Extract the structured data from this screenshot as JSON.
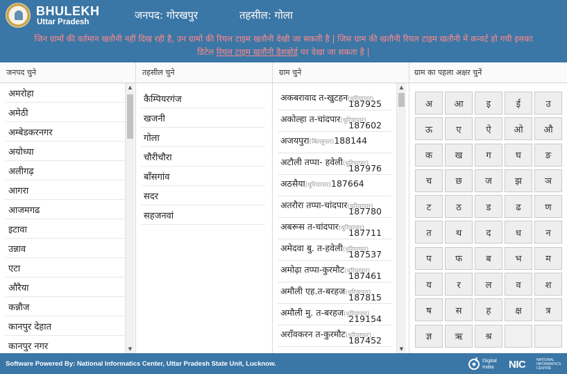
{
  "header": {
    "brand_title": "BHULEKH",
    "brand_subtitle": "Uttar Pradesh",
    "janpad_label": "जनपद: गोरखपुर",
    "tehsil_label": "तहसील: गोला"
  },
  "notice": {
    "line1": "जिन ग्रामों की वर्तमान खतौनी नहीं दिख रही है, उन ग्रामों की रियल टाइम खतौनी देखी जा सकती है | जिस ग्राम की खतौनी रियल टाइम खतौनी में कन्वर्ट हो गयी इसका",
    "line2_prefix": "डिटेल ",
    "line2_link": "रियल टाइम खतौनी डैशबोर्ड",
    "line2_suffix": " पर देखा जा सकता है |"
  },
  "columns": {
    "janpad_header": "जनपद चुने",
    "tehsil_header": "तहसील चुने",
    "gram_header": "ग्राम चुने",
    "letters_header": "ग्राम का पहला अक्षर चुनें"
  },
  "janpad_list": [
    "अमरोहा",
    "अमेठी",
    "अम्बेडकरनगर",
    "अयोध्या",
    "अलीगढ़",
    "आगरा",
    "आजमगढ",
    "इटावा",
    "उन्नाव",
    "एटा",
    "औरैया",
    "कन्नौज",
    "कानपुर देहात",
    "कानपुर नगर"
  ],
  "tehsil_list": [
    "कैम्पियरगंज",
    "खजनी",
    "गोला",
    "चौरीचौरा",
    "बाँसगांव",
    "सदर",
    "सहजनवां"
  ],
  "gram_list": [
    {
      "name": "अकबरावाद त-खुटहन",
      "tag": "(धुरियापार)",
      "code": "187925",
      "two": true
    },
    {
      "name": "अकोल्हा त-चांदपार",
      "tag": "(धुरियापार)",
      "code": "187602",
      "two": true
    },
    {
      "name": "अजयपुरा",
      "tag": "(बिल्लूपार)",
      "code": "188144",
      "two": false
    },
    {
      "name": "अटौली तप्पा- हवेली",
      "tag": "(धुरियापार)",
      "code": "187976",
      "two": true
    },
    {
      "name": "अठसैया",
      "tag": "(धुरियापार)",
      "code": "187664",
      "two": false
    },
    {
      "name": "अतरौरा तप्पा-चांदपार",
      "tag": "(धुरियापार)",
      "code": "187780",
      "two": true
    },
    {
      "name": "अबरूस त-चांदपार",
      "tag": "(धुरियापार)",
      "code": "187711",
      "two": true
    },
    {
      "name": "अमेदवा बु. त-हवेली",
      "tag": "(धुरियापार)",
      "code": "187537",
      "two": true
    },
    {
      "name": "अमोढ़ा तप्पा-कुरमौट",
      "tag": "(धुरियापार)",
      "code": "187461",
      "two": true
    },
    {
      "name": "अमौली एह.त-बरहज",
      "tag": "(धुरियापार)",
      "code": "187815",
      "two": true
    },
    {
      "name": "अमौली मु. त-बरहज",
      "tag": "(धुरियापार)",
      "code": "219154",
      "two": true
    },
    {
      "name": "अराँवकरन त-कुरमौट",
      "tag": "(धुरियापार)",
      "code": "187452",
      "two": true
    }
  ],
  "letters": [
    "अ",
    "आ",
    "इ",
    "ई",
    "उ",
    "ऊ",
    "ए",
    "ऐ",
    "ओ",
    "औ",
    "क",
    "ख",
    "ग",
    "घ",
    "ङ",
    "च",
    "छ",
    "ज",
    "झ",
    "ञ",
    "ट",
    "ठ",
    "ड",
    "ढ",
    "ण",
    "त",
    "थ",
    "द",
    "ध",
    "न",
    "प",
    "फ",
    "ब",
    "भ",
    "म",
    "य",
    "र",
    "ल",
    "व",
    "श",
    "ष",
    "स",
    "ह",
    "क्ष",
    "त्र",
    "ज्ञ",
    "ऋ",
    "श्र",
    "",
    ""
  ],
  "footer": {
    "text": "Software Powered By: National Informatics Center, Uttar Pradesh State Unit, Lucknow.",
    "digital_india_line1": "Digital",
    "digital_india_line2": "India",
    "nic_logo": "NIC",
    "nic_line1": "NATIONAL",
    "nic_line2": "INFORMATICS",
    "nic_line3": "CENTRE"
  },
  "colors": {
    "header_bg": "#3a76a6",
    "notice_text": "#ff8a8a",
    "key_bg": "#eeeeee"
  },
  "icons": {
    "logo": "up-govt-emblem-logo",
    "digital_india": "digital-india-logo"
  }
}
